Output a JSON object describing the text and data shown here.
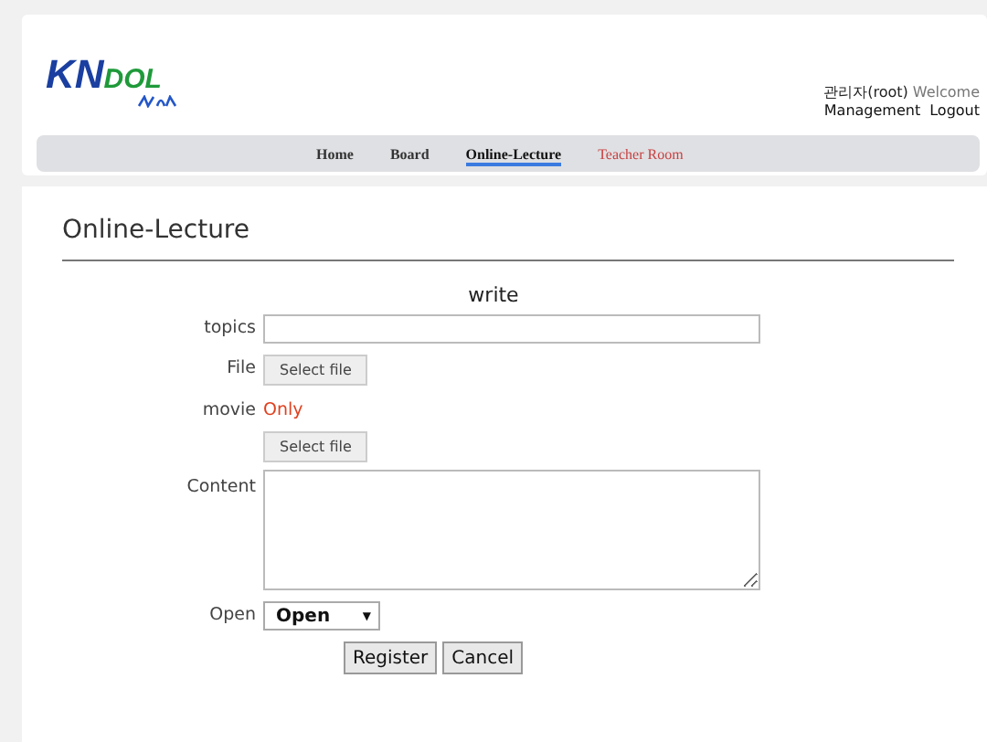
{
  "logo": {
    "primary": "KN",
    "secondary": "DOL"
  },
  "user_bar": {
    "user": "관리자(root)",
    "greeting": "Welcome",
    "links": [
      "Management",
      "Logout"
    ]
  },
  "nav": [
    {
      "label": "Home",
      "selected": false,
      "kind": "normal"
    },
    {
      "label": "Board",
      "selected": false,
      "kind": "normal"
    },
    {
      "label": "Online-Lecture",
      "selected": true,
      "kind": "normal"
    },
    {
      "label": "Teacher Room",
      "selected": false,
      "kind": "accent"
    }
  ],
  "page_title": "Online-Lecture",
  "form": {
    "heading": "write",
    "topics_label": "topics",
    "file_label": "File",
    "file_button": "Select file",
    "movie_label": "movie",
    "movie_note": "Only",
    "movie_button": "Select file",
    "content_label": "Content",
    "open_label": "Open",
    "open_value": "Open",
    "arrow": "▼",
    "buttons": [
      "Register",
      "Cancel"
    ]
  }
}
